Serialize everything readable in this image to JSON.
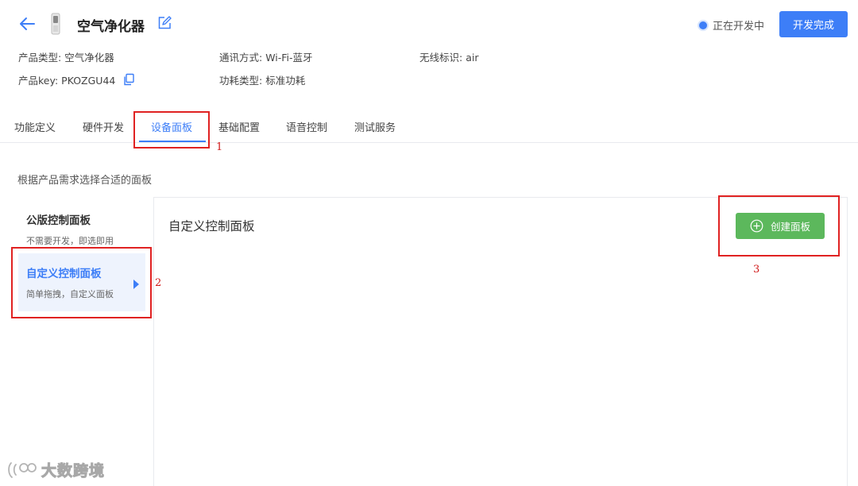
{
  "header": {
    "title": "空气净化器",
    "status_text": "正在开发中",
    "finish_button": "开发完成",
    "meta": {
      "product_type_label": "产品类型:",
      "product_type_value": "空气净化器",
      "comm_label": "通讯方式:",
      "comm_value": "Wi-Fi-蓝牙",
      "wireless_label": "无线标识:",
      "wireless_value": "air",
      "key_label": "产品key:",
      "key_value": "PKOZGU44",
      "power_label": "功耗类型:",
      "power_value": "标准功耗"
    }
  },
  "tabs": [
    "功能定义",
    "硬件开发",
    "设备面板",
    "基础配置",
    "语音控制",
    "测试服务"
  ],
  "active_tab": "设备面板",
  "section_hint": "根据产品需求选择合适的面板",
  "sidebar": [
    {
      "title": "公版控制面板",
      "subtitle": "不需要开发，即选即用"
    },
    {
      "title": "自定义控制面板",
      "subtitle": "简单拖拽，自定义面板"
    }
  ],
  "panel": {
    "title": "自定义控制面板",
    "create_button": "创建面板"
  },
  "annotations": [
    "1",
    "2",
    "3"
  ],
  "watermark": "大数跨境",
  "colors": {
    "primary": "#3d7ef7",
    "success": "#5cb85c",
    "annotation": "#e02222"
  }
}
